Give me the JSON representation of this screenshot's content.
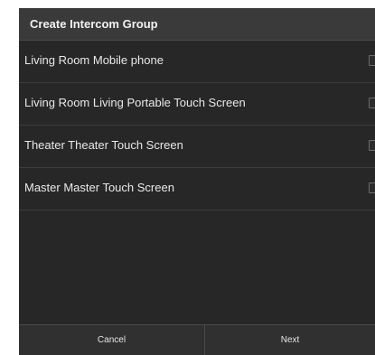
{
  "dialog": {
    "title": "Create Intercom Group",
    "items": [
      {
        "label": "Living Room Mobile phone",
        "checked": false
      },
      {
        "label": "Living Room Living Portable Touch Screen",
        "checked": false
      },
      {
        "label": "Theater Theater Touch Screen",
        "checked": false
      },
      {
        "label": "Master Master Touch Screen",
        "checked": false
      }
    ],
    "buttons": {
      "cancel": "Cancel",
      "next": "Next"
    }
  },
  "colors": {
    "background": "#272727",
    "title_bar": "#3a3a3a",
    "text": "#e9e9e9"
  }
}
